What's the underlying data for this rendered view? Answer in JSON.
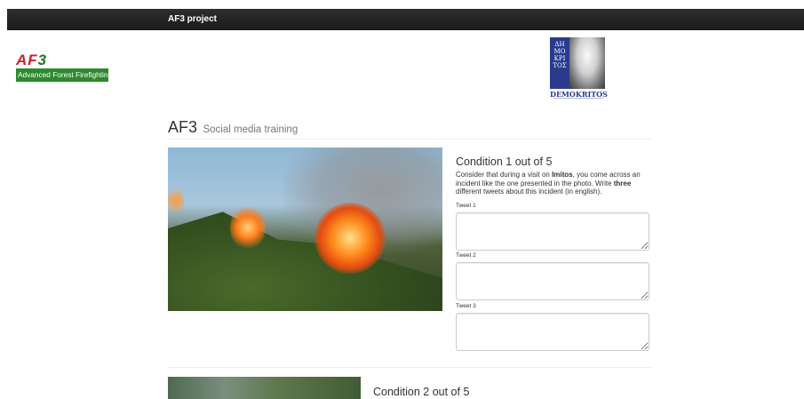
{
  "navbar": {
    "brand": "AF3 project"
  },
  "logos": {
    "af3": {
      "letters_a": "AF",
      "letters_b": "3",
      "tagline": "Advanced Forest Firefighting"
    },
    "demokritos": {
      "greek": "ΔΗ ΜΟ ΚΡΙ ΤΟΣ",
      "name": "DEMOKRITOS"
    }
  },
  "header": {
    "title": "AF3",
    "subtitle": "Social media training"
  },
  "conditions": [
    {
      "title": "Condition 1 out of 5",
      "text_pre": "Consider that during a visit on ",
      "location": "Imitos",
      "text_mid": ", you come across an incident like the one presented in the photo. Write ",
      "count": "three",
      "text_post": " different tweets about this incident (in english).",
      "tweets": [
        {
          "label": "Tweet 1",
          "value": ""
        },
        {
          "label": "Tweet 2",
          "value": ""
        },
        {
          "label": "Tweet 3",
          "value": ""
        }
      ]
    },
    {
      "title": "Condition 2 out of 5"
    }
  ],
  "colors": {
    "navbar": "#222222",
    "af3_red": "#c8232b",
    "af3_green": "#2d8a2d",
    "demokritos_blue": "#2a3b8f"
  }
}
